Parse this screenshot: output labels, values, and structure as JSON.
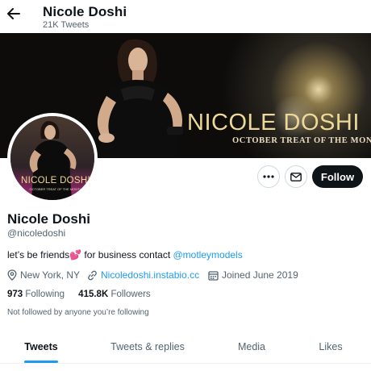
{
  "header": {
    "title": "Nicole Doshi",
    "tweet_count": "21K Tweets"
  },
  "banner": {
    "title": "NICOLE DOSHI",
    "subtitle": "OCTOBER TREAT OF THE MONTH"
  },
  "avatar": {
    "title": "NICOLE DOSHI",
    "subtitle": "OCTOBER TREAT OF THE MONTH"
  },
  "actions": {
    "more_icon": "more-dots-icon",
    "message_icon": "envelope-icon",
    "follow_label": "Follow"
  },
  "profile": {
    "name": "Nicole Doshi",
    "handle": "@nicoledoshi",
    "bio_text": "let’s be friends💕 for business contact ",
    "bio_link": "@motleymodels",
    "location": "New York, NY",
    "website": "Nicoledoshi.instabio.cc",
    "joined": "Joined June 2019",
    "following_count": "973",
    "following_label": "Following",
    "followers_count": "415.8K",
    "followers_label": "Followers",
    "followed_by_note": "Not followed by anyone you’re following"
  },
  "tabs": [
    {
      "label": "Tweets",
      "active": true
    },
    {
      "label": "Tweets & replies",
      "active": false
    },
    {
      "label": "Media",
      "active": false
    },
    {
      "label": "Likes",
      "active": false
    }
  ],
  "colors": {
    "accent": "#1d9bf0",
    "text": "#0f1419",
    "secondary": "#536471",
    "banner_gold": "#ecd898"
  }
}
